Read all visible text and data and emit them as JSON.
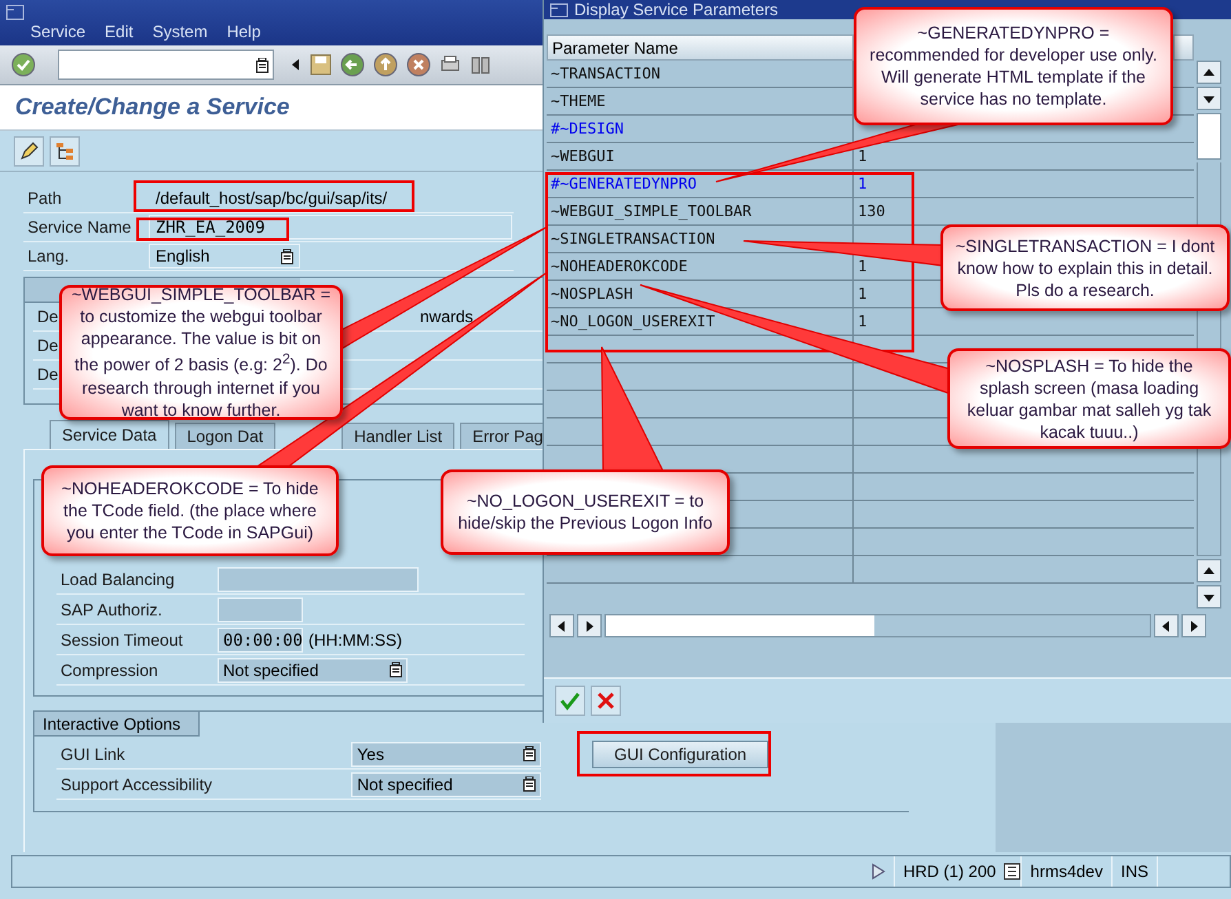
{
  "main_window": {
    "menu": [
      "Service",
      "Edit",
      "System",
      "Help"
    ],
    "title": "Create/Change a Service",
    "fields": [
      {
        "label": "Path",
        "value": "/default_host/sap/bc/gui/sap/its/",
        "kind": "plain"
      },
      {
        "label": "Service Name",
        "value": "ZHR_EA_2009",
        "kind": "mono"
      },
      {
        "label": "Lang.",
        "value": "English",
        "kind": "dropdown"
      }
    ],
    "description_rows": [
      {
        "label": "De",
        "value": "nwards"
      },
      {
        "label": "De"
      },
      {
        "label": "De"
      }
    ],
    "tabs": [
      {
        "label": "Service Data",
        "selected": true
      },
      {
        "label": "Logon Dat",
        "selected": false
      },
      {
        "label": "Handler List",
        "selected": false
      },
      {
        "label": "Error Pag",
        "selected": false
      }
    ],
    "service_fields": [
      {
        "label": "Load Balancing",
        "kind": "wide"
      },
      {
        "label": "SAP Authoriz.",
        "kind": "short"
      },
      {
        "label": "Session Timeout",
        "kind": "time",
        "value": "00:00:00",
        "suffix": "(HH:MM:SS)"
      },
      {
        "label": "Compression",
        "kind": "dropdown",
        "value": "Not specified"
      }
    ],
    "interactive_options": {
      "title": "Interactive Options",
      "rows": [
        {
          "label": "GUI Link",
          "value": "Yes"
        },
        {
          "label": "Support Accessibility",
          "value": "Not specified"
        }
      ],
      "button": "GUI Configuration"
    },
    "status_bar": {
      "system": "HRD (1) 200",
      "server": "hrms4dev",
      "mode": "INS"
    }
  },
  "dialog": {
    "title": "Display Service Parameters",
    "column": "Parameter Name",
    "rows": [
      {
        "name": "~TRANSACTION",
        "marked": false
      },
      {
        "name": "~THEME",
        "marked": false
      },
      {
        "name": "#~DESIGN",
        "marked": true
      },
      {
        "name": "~WEBGUI",
        "value": "1",
        "marked": false
      },
      {
        "name": "#~GENERATEDYNPRO",
        "value": "1",
        "marked": true
      },
      {
        "name": "~WEBGUI_SIMPLE_TOOLBAR",
        "value": "130",
        "marked": false
      },
      {
        "name": "~SINGLETRANSACTION",
        "marked": false
      },
      {
        "name": "~NOHEADEROKCODE",
        "value": "1",
        "marked": false
      },
      {
        "name": "~NOSPLASH",
        "value": "1",
        "marked": false
      },
      {
        "name": "~NO_LOGON_USEREXIT",
        "value": "1",
        "marked": false
      }
    ]
  },
  "callouts": [
    {
      "text": "~GENERATEDYNPRO = recommended for developer use only. Will generate HTML template if the service has no template."
    },
    {
      "text": "~WEBGUI_SIMPLE_TOOLBAR = to customize the webgui toolbar appearance. The value is bit on the power of 2 basis (e.g: 2$^{2}$). Do research through internet if you want to know further."
    },
    {
      "text": "~SINGLETRANSACTION = I dont know how to explain this in detail. Pls do a research."
    },
    {
      "text": "~NOSPLASH = To hide the splash screen (masa loading keluar gambar mat salleh yg tak kacak tuuu..)"
    },
    {
      "text": "~NOHEADEROKCODE = To hide the TCode field. (the place where you enter the TCode in SAPGui)"
    },
    {
      "text": "~NO_LOGON_USEREXIT = to hide/skip the Previous Logon Info"
    }
  ]
}
